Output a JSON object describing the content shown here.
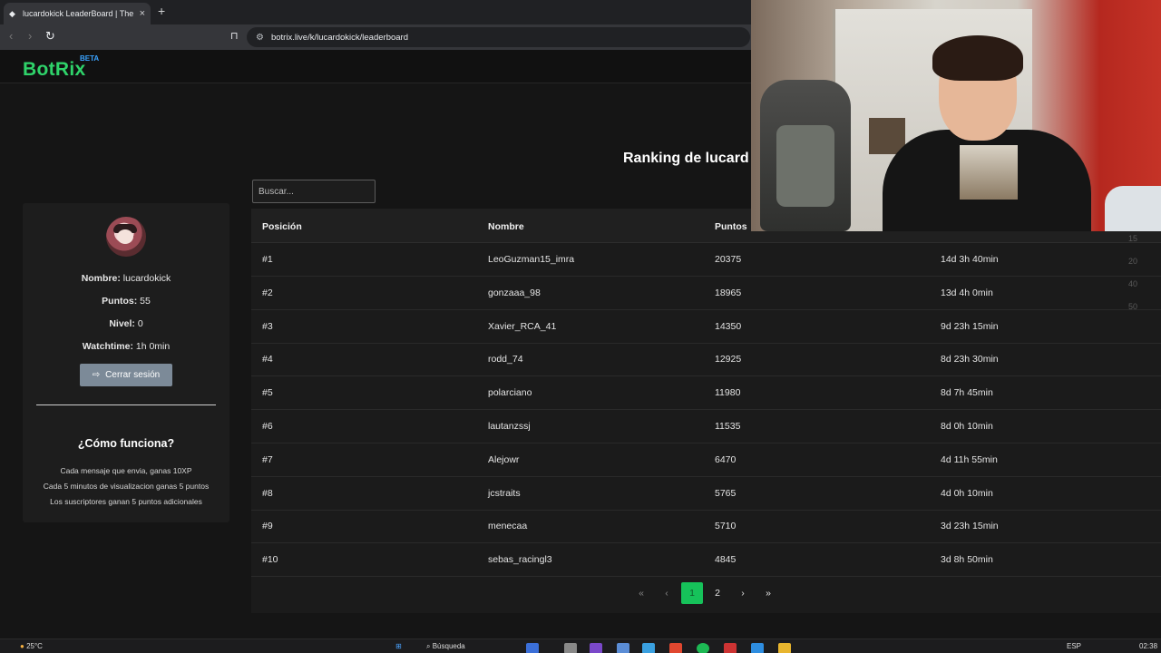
{
  "browser": {
    "tab_title": "lucardokick LeaderBoard | The b",
    "tab_favicon": "diamond-icon",
    "url": "botrix.live/k/lucardokick/leaderboard",
    "new_tab": "+",
    "close_glyph": "×"
  },
  "site": {
    "logo": "BotRix",
    "badge": "BETA",
    "brand_color": "#2fd36a"
  },
  "ranking_title": "Ranking de lucard",
  "search": {
    "placeholder": "Buscar..."
  },
  "profile": {
    "name_label": "Nombre:",
    "name": "lucardokick",
    "points_label": "Puntos:",
    "points": "55",
    "level_label": "Nivel:",
    "level": "0",
    "watchtime_label": "Watchtime:",
    "watchtime": "1h 0min",
    "logout_label": "Cerrar sesión"
  },
  "how": {
    "title": "¿Cómo funciona?",
    "lines": [
      "Cada mensaje que envia, ganas 10XP",
      "Cada 5 minutos de visualizacion ganas 5 puntos",
      "Los suscriptores ganan 5 puntos adicionales"
    ]
  },
  "table": {
    "headers": [
      "Posición",
      "Nombre",
      "Puntos"
    ],
    "rows": [
      [
        "#1",
        "LeoGuzman15_imra",
        "20375",
        "14d 3h 40min"
      ],
      [
        "#2",
        "gonzaaa_98",
        "18965",
        "13d 4h 0min"
      ],
      [
        "#3",
        "Xavier_RCA_41",
        "14350",
        "9d 23h 15min"
      ],
      [
        "#4",
        "rodd_74",
        "12925",
        "8d 23h 30min"
      ],
      [
        "#5",
        "polarciano",
        "11980",
        "8d 7h 45min"
      ],
      [
        "#6",
        "lautanzssj",
        "11535",
        "8d 0h 10min"
      ],
      [
        "#7",
        "Alejowr",
        "6470",
        "4d 11h 55min"
      ],
      [
        "#8",
        "jcstraits",
        "5765",
        "4d 0h 10min"
      ],
      [
        "#9",
        "menecaa",
        "5710",
        "3d 23h 15min"
      ],
      [
        "#10",
        "sebas_racingl3",
        "4845",
        "3d 8h 50min"
      ]
    ]
  },
  "pagination": {
    "first": "«",
    "prev": "‹",
    "pages": [
      "1",
      "2"
    ],
    "next": "›",
    "last": "»"
  },
  "page_size_options": [
    "15",
    "20",
    "40",
    "50"
  ],
  "taskbar": {
    "weather": "25°C",
    "search": "Búsqueda",
    "lang": "ESP",
    "time": "02:38"
  }
}
